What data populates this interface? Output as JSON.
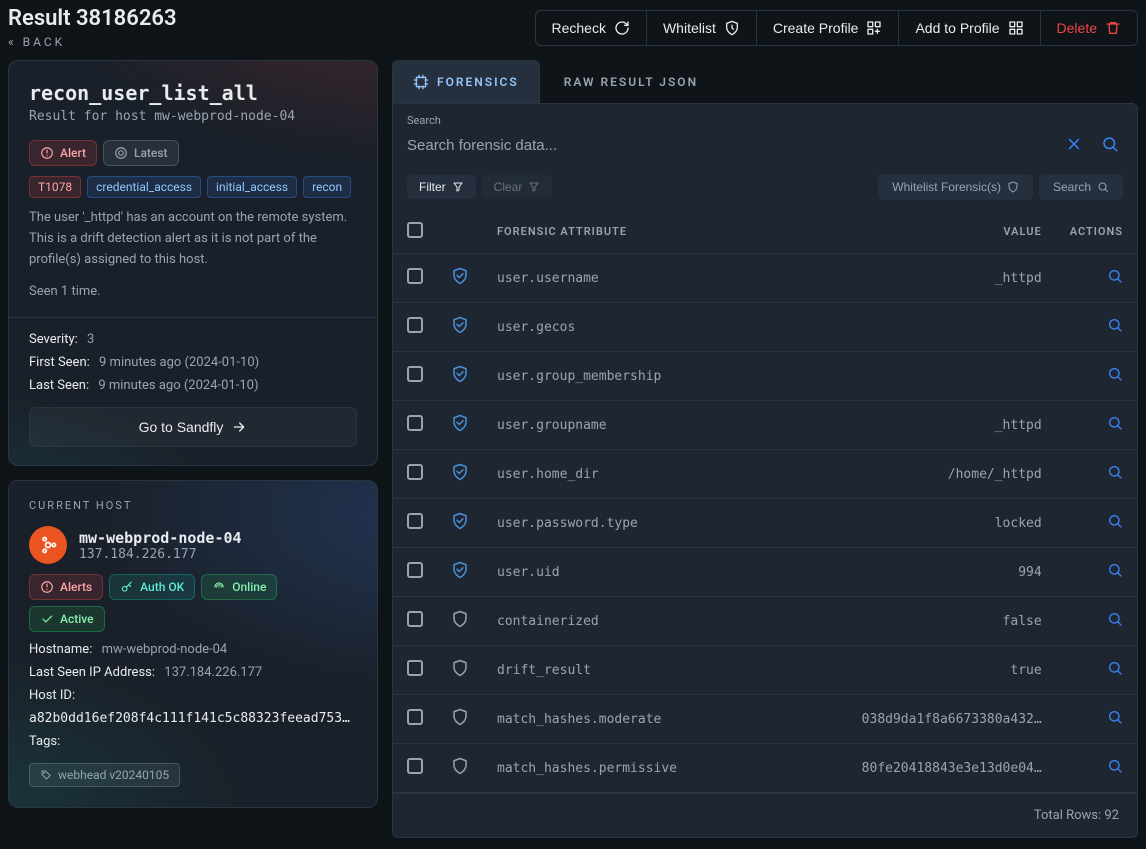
{
  "header": {
    "title": "Result 38186263",
    "back_label": "« BACK",
    "actions": {
      "recheck": "Recheck",
      "whitelist": "Whitelist",
      "create_profile": "Create Profile",
      "add_to_profile": "Add to Profile",
      "delete": "Delete"
    }
  },
  "result_card": {
    "name": "recon_user_list_all",
    "subtitle": "Result for host mw-webprod-node-04",
    "chips": {
      "alert": "Alert",
      "latest": "Latest"
    },
    "tags": [
      "T1078",
      "credential_access",
      "initial_access",
      "recon"
    ],
    "description": "The user '_httpd' has an account on the remote system. This is a drift detection alert as it is not part of the profile(s) assigned to this host.",
    "seen_text": "Seen 1 time.",
    "severity_label": "Severity:",
    "severity_value": "3",
    "first_seen_label": "First Seen:",
    "first_seen_value": "9 minutes ago (2024-01-10)",
    "last_seen_label": "Last Seen:",
    "last_seen_value": "9 minutes ago (2024-01-10)",
    "go_button": "Go to Sandfly"
  },
  "host_card": {
    "eyebrow": "CURRENT HOST",
    "name": "mw-webprod-node-04",
    "ip": "137.184.226.177",
    "chips": {
      "alerts": "Alerts",
      "auth_ok": "Auth OK",
      "online": "Online",
      "active": "Active"
    },
    "hostname_label": "Hostname:",
    "hostname_value": "mw-webprod-node-04",
    "last_ip_label": "Last Seen IP Address:",
    "last_ip_value": "137.184.226.177",
    "host_id_label": "Host ID:",
    "host_id_value": "a82b0dd16ef208f4c111f141c5c88323feead753d…",
    "tags_label": "Tags:",
    "tag_value": "webhead v20240105"
  },
  "tabs": {
    "forensics": "FORENSICS",
    "raw": "RAW RESULT JSON"
  },
  "search": {
    "label": "Search",
    "placeholder": "Search forensic data..."
  },
  "filters": {
    "filter": "Filter",
    "clear": "Clear",
    "whitelist_forensics": "Whitelist Forensic(s)",
    "search": "Search"
  },
  "table": {
    "columns": {
      "forensic_attribute": "FORENSIC ATTRIBUTE",
      "value": "VALUE",
      "actions": "ACTIONS"
    },
    "rows": [
      {
        "attr": "user.username",
        "value": "_httpd",
        "shield": "filled"
      },
      {
        "attr": "user.gecos",
        "value": "",
        "shield": "filled"
      },
      {
        "attr": "user.group_membership",
        "value": "",
        "shield": "filled"
      },
      {
        "attr": "user.groupname",
        "value": "_httpd",
        "shield": "filled"
      },
      {
        "attr": "user.home_dir",
        "value": "/home/_httpd",
        "shield": "filled"
      },
      {
        "attr": "user.password.type",
        "value": "locked",
        "shield": "filled"
      },
      {
        "attr": "user.uid",
        "value": "994",
        "shield": "filled"
      },
      {
        "attr": "containerized",
        "value": "false",
        "shield": "muted"
      },
      {
        "attr": "drift_result",
        "value": "true",
        "shield": "muted"
      },
      {
        "attr": "match_hashes.moderate",
        "value": "038d9da1f8a6673380a432…",
        "shield": "muted"
      },
      {
        "attr": "match_hashes.permissive",
        "value": "80fe20418843e3e13d0e04…",
        "shield": "muted"
      }
    ],
    "footer_label": "Total Rows:",
    "footer_value": "92"
  }
}
